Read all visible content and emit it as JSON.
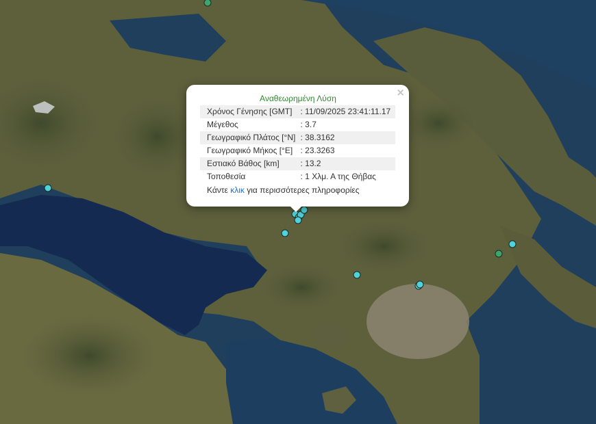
{
  "popup": {
    "title": "Αναθεωρημένη Λύση",
    "close_label": "×",
    "rows": [
      {
        "label": "Χρόνος Γένησης [GMT]",
        "value": ": 11/09/2025 23:41:11.17"
      },
      {
        "label": "Μέγεθος",
        "value": ": 3.7"
      },
      {
        "label": "Γεωγραφικό Πλάτος [°N]",
        "value": ": 38.3162"
      },
      {
        "label": "Γεωγραφικό Μήκος [°E]",
        "value": ": 23.3263"
      },
      {
        "label": "Εστιακό Βάθος [km]",
        "value": ": 13.2"
      },
      {
        "label": "Τοποθεσία",
        "value": ": 1 Χλμ. Α της Θήβας"
      }
    ],
    "more_prefix": "Κάντε ",
    "more_link": "κλικ",
    "more_suffix": " για περισσότερες πληροφορίες"
  },
  "colors": {
    "marker_cyan": "#4fd2d8",
    "marker_green": "#3fa66b",
    "sea": "#1f3f5c",
    "gulf": "#152b52",
    "land": "#5d5f3c"
  }
}
